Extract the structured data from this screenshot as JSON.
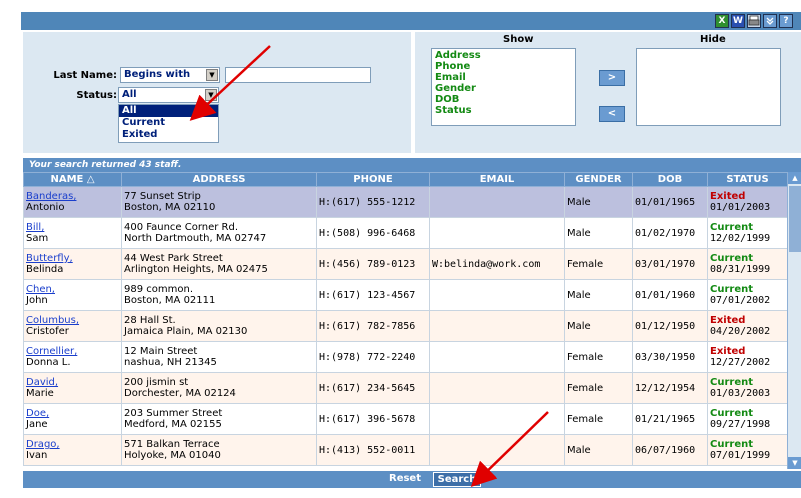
{
  "toolbar": {
    "icons": [
      "excel-icon",
      "word-icon",
      "print-icon",
      "collapse-icon",
      "help-icon"
    ],
    "excel_label": "X",
    "word_label": "W",
    "help_label": "?"
  },
  "search": {
    "last_name_label": "Last Name:",
    "match_mode": "Begins with",
    "last_name_value": "",
    "status_label": "Status:",
    "status_value": "All",
    "status_options": [
      "All",
      "Current",
      "Exited"
    ]
  },
  "columns_panel": {
    "show_header": "Show",
    "hide_header": "Hide",
    "show_items": [
      "Address",
      "Phone",
      "Email",
      "Gender",
      "DOB",
      "Status"
    ],
    "hide_items": [],
    "move_right_label": ">",
    "move_left_label": "<"
  },
  "results": {
    "summary": "Your search returned 43 staff.",
    "headers": [
      "NAME △",
      "ADDRESS",
      "PHONE",
      "EMAIL",
      "GENDER",
      "DOB",
      "STATUS"
    ],
    "rows": [
      {
        "last": "Banderas,",
        "first": "Antonio",
        "addr1": "77 Sunset Strip",
        "addr2": "Boston, MA 02110",
        "phone": "H:(617) 555-1212",
        "email": "",
        "gender": "Male",
        "dob": "01/01/1965",
        "status": "Exited",
        "status_date": "01/01/2003"
      },
      {
        "last": "Bill,",
        "first": "Sam",
        "addr1": "400 Faunce Corner Rd.",
        "addr2": "North Dartmouth, MA 02747",
        "phone": "H:(508) 996-6468",
        "email": "",
        "gender": "Male",
        "dob": "01/02/1970",
        "status": "Current",
        "status_date": "12/02/1999"
      },
      {
        "last": "Butterfly,",
        "first": "Belinda",
        "addr1": "44 West Park Street",
        "addr2": "Arlington Heights, MA 02475",
        "phone": "H:(456) 789-0123",
        "email": "W:belinda@work.com",
        "gender": "Female",
        "dob": "03/01/1970",
        "status": "Current",
        "status_date": "08/31/1999"
      },
      {
        "last": "Chen,",
        "first": "John",
        "addr1": "989 common.",
        "addr2": "Boston, MA 02111",
        "phone": "H:(617) 123-4567",
        "email": "",
        "gender": "Male",
        "dob": "01/01/1960",
        "status": "Current",
        "status_date": "07/01/2002"
      },
      {
        "last": "Columbus,",
        "first": "Cristofer",
        "addr1": "28 Hall St.",
        "addr2": "Jamaica Plain, MA 02130",
        "phone": "H:(617) 782-7856",
        "email": "",
        "gender": "Male",
        "dob": "01/12/1950",
        "status": "Exited",
        "status_date": "04/20/2002"
      },
      {
        "last": "Cornellier,",
        "first": "Donna L.",
        "addr1": "12 Main Street",
        "addr2": "nashua, NH 21345",
        "phone": "H:(978) 772-2240",
        "email": "",
        "gender": "Female",
        "dob": "03/30/1950",
        "status": "Exited",
        "status_date": "12/27/2002"
      },
      {
        "last": "David,",
        "first": "Marie",
        "addr1": "200 jismin st",
        "addr2": "Dorchester, MA 02124",
        "phone": "H:(617) 234-5645",
        "email": "",
        "gender": "Female",
        "dob": "12/12/1954",
        "status": "Current",
        "status_date": "01/03/2003"
      },
      {
        "last": "Doe,",
        "first": "Jane",
        "addr1": "203 Summer Street",
        "addr2": "Medford, MA 02155",
        "phone": "H:(617) 396-5678",
        "email": "",
        "gender": "Female",
        "dob": "01/21/1965",
        "status": "Current",
        "status_date": "09/27/1998"
      },
      {
        "last": "Drago,",
        "first": "Ivan",
        "addr1": "571 Balkan Terrace",
        "addr2": "Holyoke, MA 01040",
        "phone": "H:(413) 552-0011",
        "email": "",
        "gender": "Male",
        "dob": "06/07/1960",
        "status": "Current",
        "status_date": "07/01/1999"
      }
    ]
  },
  "footer": {
    "reset_label": "Reset",
    "search_label": "Search"
  },
  "colors": {
    "header_blue": "#5d8fc4",
    "panel_bg": "#dce8f2",
    "current_green": "#138a13",
    "exited_red": "#c00000",
    "annotation_red": "#e00000"
  }
}
